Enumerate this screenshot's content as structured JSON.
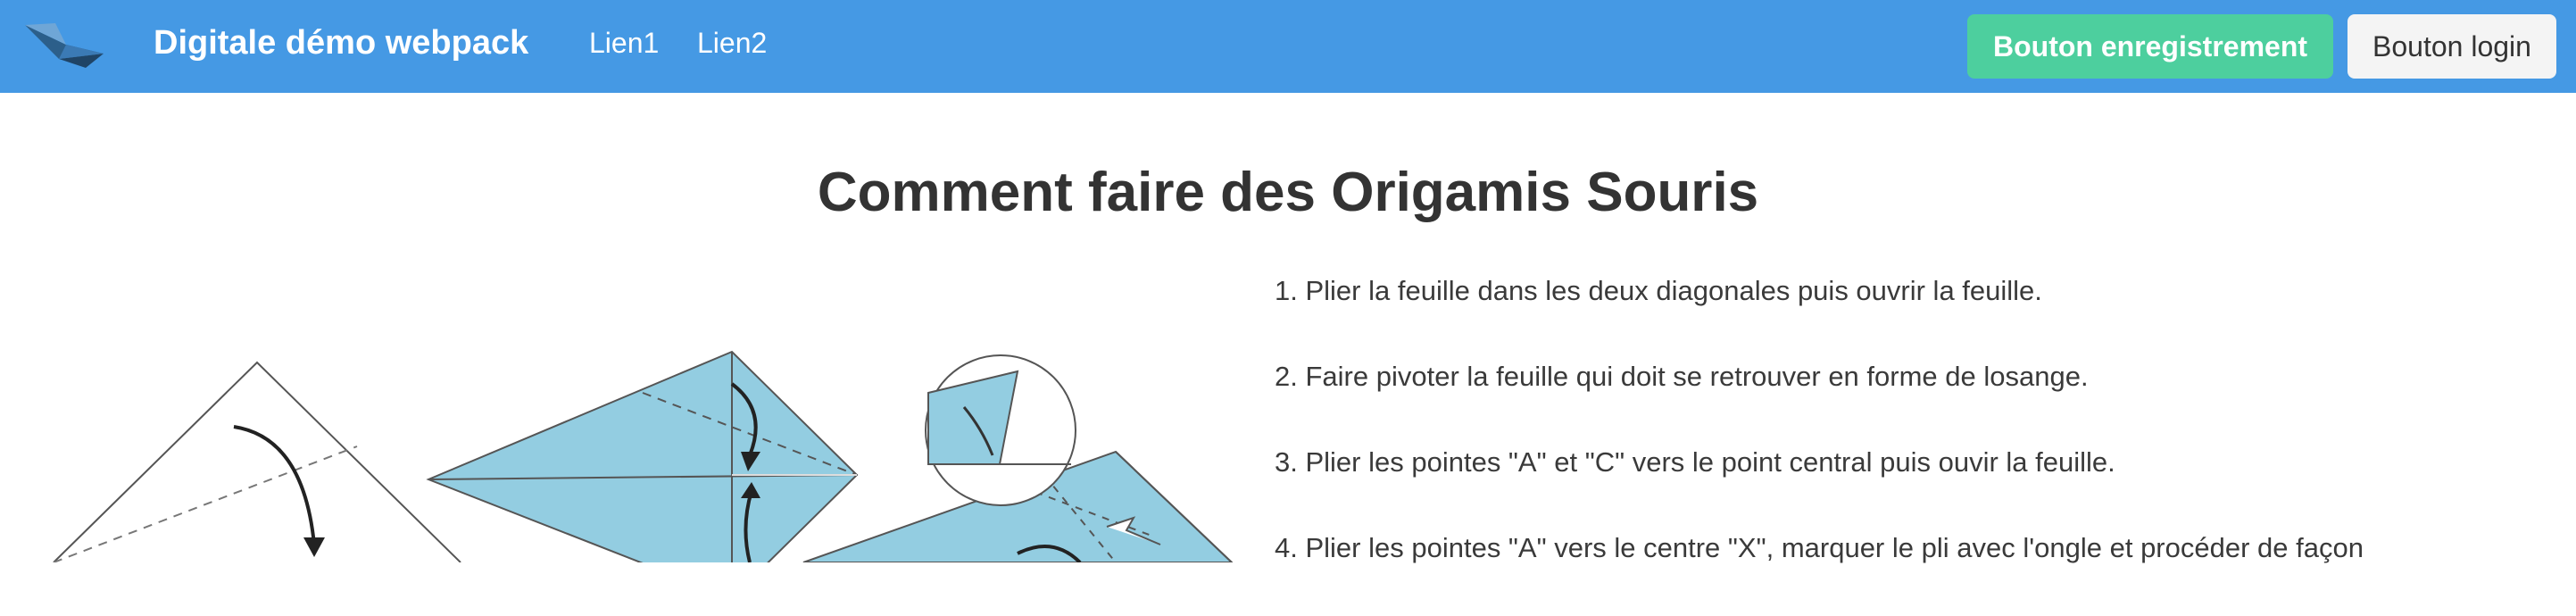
{
  "navbar": {
    "brand": "Digitale démo webpack",
    "links": [
      "Lien1",
      "Lien2"
    ],
    "register_button": "Bouton enregistrement",
    "login_button": "Bouton login",
    "colors": {
      "background": "#4599e4",
      "register": "#4dcf9e",
      "login": "#f4f4f4"
    },
    "logo_icon": "paper-boat-logo-icon"
  },
  "main": {
    "title": "Comment faire des Origamis Souris",
    "diagram_icon": "origami-mouse-steps-diagram",
    "steps": [
      "Plier la feuille dans les deux diagonales puis ouvrir la feuille.",
      "Faire pivoter la feuille qui doit se retrouver en forme de losange.",
      "Plier les pointes \"A\" et \"C\" vers le point central puis ouvir la feuille.",
      "Plier les pointes \"A\" vers le centre \"X\", marquer le pli avec l'ongle et procéder de façon"
    ],
    "step_numbers": [
      "1.",
      "2.",
      "3.",
      "4."
    ]
  }
}
